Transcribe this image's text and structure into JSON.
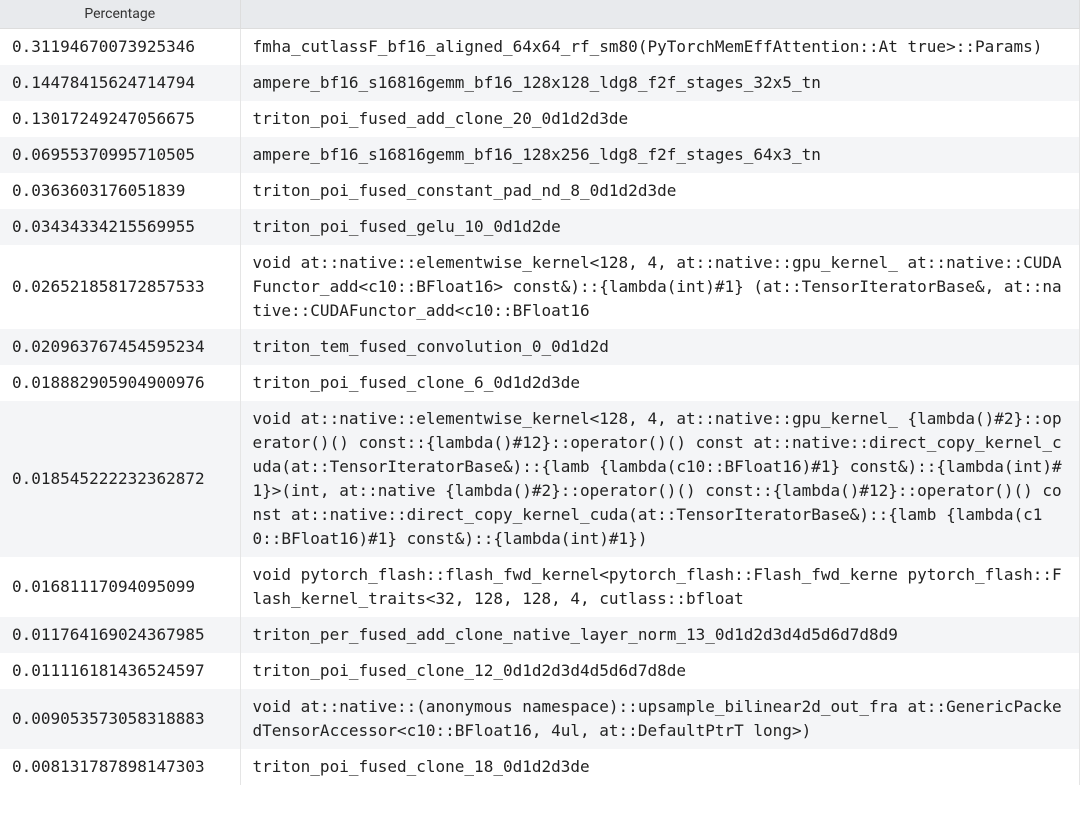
{
  "table": {
    "headers": {
      "percentage": "Percentage",
      "name": ""
    },
    "rows": [
      {
        "percentage": "0.31194670073925346",
        "name": "fmha_cutlassF_bf16_aligned_64x64_rf_sm80(PyTorchMemEffAttention::At true>::Params)"
      },
      {
        "percentage": "0.14478415624714794",
        "name": "ampere_bf16_s16816gemm_bf16_128x128_ldg8_f2f_stages_32x5_tn"
      },
      {
        "percentage": "0.13017249247056675",
        "name": "triton_poi_fused_add_clone_20_0d1d2d3de"
      },
      {
        "percentage": "0.06955370995710505",
        "name": "ampere_bf16_s16816gemm_bf16_128x256_ldg8_f2f_stages_64x3_tn"
      },
      {
        "percentage": "0.0363603176051839",
        "name": "triton_poi_fused_constant_pad_nd_8_0d1d2d3de"
      },
      {
        "percentage": "0.03434334215569955",
        "name": "triton_poi_fused_gelu_10_0d1d2de"
      },
      {
        "percentage": "0.026521858172857533",
        "name": "void at::native::elementwise_kernel<128, 4, at::native::gpu_kernel_ at::native::CUDAFunctor_add<c10::BFloat16> const&)::{lambda(int)#1} (at::TensorIteratorBase&, at::native::CUDAFunctor_add<c10::BFloat16"
      },
      {
        "percentage": "0.020963767454595234",
        "name": "triton_tem_fused_convolution_0_0d1d2d"
      },
      {
        "percentage": "0.018882905904900976",
        "name": "triton_poi_fused_clone_6_0d1d2d3de"
      },
      {
        "percentage": "0.018545222232362872",
        "name": "void at::native::elementwise_kernel<128, 4, at::native::gpu_kernel_ {lambda()#2}::operator()() const::{lambda()#12}::operator()() const at::native::direct_copy_kernel_cuda(at::TensorIteratorBase&)::{lamb {lambda(c10::BFloat16)#1} const&)::{lambda(int)#1}>(int, at::native {lambda()#2}::operator()() const::{lambda()#12}::operator()() const at::native::direct_copy_kernel_cuda(at::TensorIteratorBase&)::{lamb {lambda(c10::BFloat16)#1} const&)::{lambda(int)#1})"
      },
      {
        "percentage": "0.01681117094095099",
        "name": "void pytorch_flash::flash_fwd_kernel<pytorch_flash::Flash_fwd_kerne pytorch_flash::Flash_kernel_traits<32, 128, 128, 4, cutlass::bfloat"
      },
      {
        "percentage": "0.011764169024367985",
        "name": "triton_per_fused_add_clone_native_layer_norm_13_0d1d2d3d4d5d6d7d8d9"
      },
      {
        "percentage": "0.011116181436524597",
        "name": "triton_poi_fused_clone_12_0d1d2d3d4d5d6d7d8de"
      },
      {
        "percentage": "0.009053573058318883",
        "name": "void at::native::(anonymous namespace)::upsample_bilinear2d_out_fra at::GenericPackedTensorAccessor<c10::BFloat16, 4ul, at::DefaultPtrT long>)"
      },
      {
        "percentage": "0.008131787898147303",
        "name": "triton_poi_fused_clone_18_0d1d2d3de"
      }
    ]
  }
}
